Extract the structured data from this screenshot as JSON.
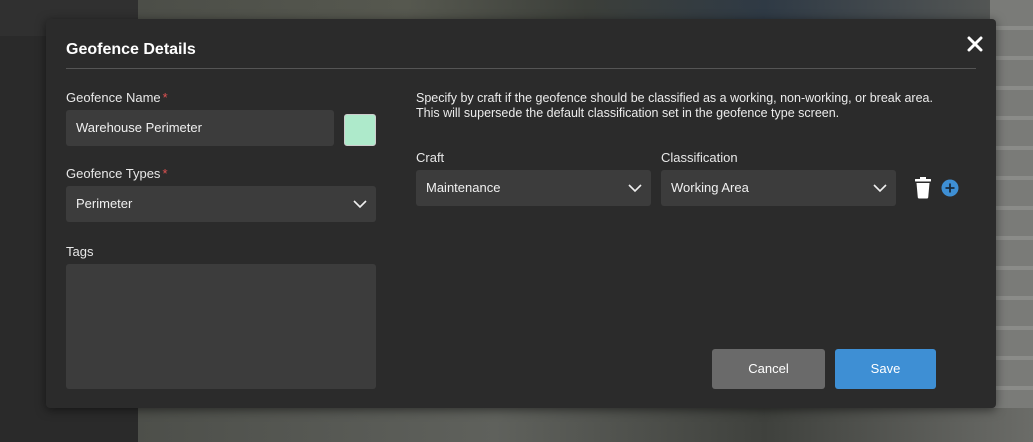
{
  "modal": {
    "title": "Geofence Details",
    "close_label": "✕"
  },
  "left": {
    "name_label": "Geofence Name",
    "name_required": "*",
    "name_value": "Warehouse Perimeter",
    "swatch_color": "#aeeacb",
    "types_label": "Geofence Types",
    "types_required": "*",
    "types_value": "Perimeter",
    "tags_label": "Tags"
  },
  "right": {
    "description_line1": "Specify by craft if the geofence should be classified as a working, non-working, or break area.",
    "description_line2": "This will supersede the default classification set in the geofence type screen.",
    "craft_label": "Craft",
    "craft_value": "Maintenance",
    "classification_label": "Classification",
    "classification_value": "Working Area"
  },
  "actions": {
    "cancel_label": "Cancel",
    "save_label": "Save",
    "save_color": "#3e8fd4",
    "add_color": "#3e8fd4"
  },
  "icons": {
    "delete": "trash-icon",
    "add": "plus-circle-icon",
    "close": "close-icon",
    "dropdown": "chevron-down-icon"
  }
}
